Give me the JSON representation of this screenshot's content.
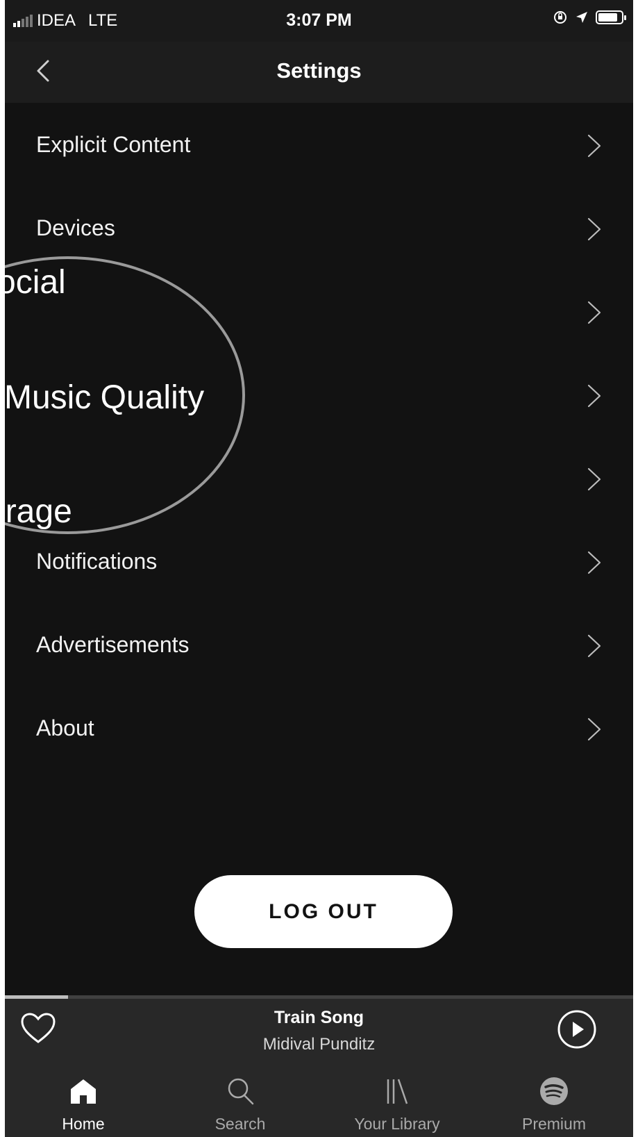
{
  "status_bar": {
    "carrier": "IDEA",
    "network": "LTE",
    "time": "3:07 PM",
    "battery_level": 0.85
  },
  "header": {
    "title": "Settings"
  },
  "settings": {
    "items": [
      {
        "label": "Explicit Content"
      },
      {
        "label": "Devices"
      },
      {
        "label": ""
      },
      {
        "label": ""
      },
      {
        "label": ""
      },
      {
        "label": "Notifications"
      },
      {
        "label": "Advertisements"
      },
      {
        "label": "About"
      }
    ]
  },
  "magnifier": {
    "line1": "ocial",
    "line2": "Music Quality",
    "line3": "orage"
  },
  "logout": {
    "label": "LOG OUT"
  },
  "now_playing": {
    "title": "Train Song",
    "artist": "Midival Punditz",
    "progress": 0.1
  },
  "tabs": [
    {
      "label": "Home",
      "icon": "home-icon",
      "active": true
    },
    {
      "label": "Search",
      "icon": "search-icon",
      "active": false
    },
    {
      "label": "Your Library",
      "icon": "library-icon",
      "active": false
    },
    {
      "label": "Premium",
      "icon": "spotify-icon",
      "active": false
    }
  ],
  "colors": {
    "background": "#121212",
    "header": "#1d1d1d",
    "player": "#282828",
    "text": "#ffffff",
    "muted": "#aaaaaa"
  }
}
